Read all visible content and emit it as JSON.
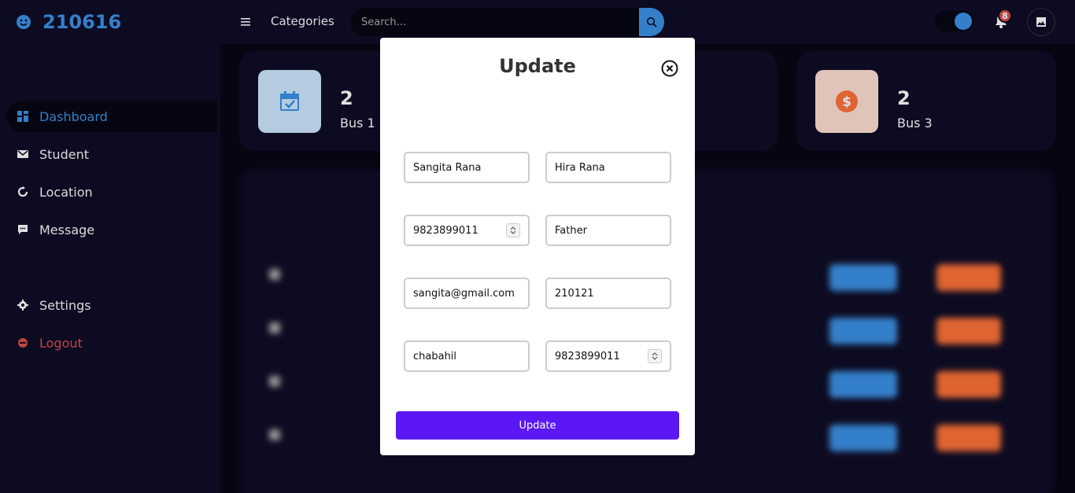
{
  "brand": {
    "name": "210616",
    "icon": "smile-icon"
  },
  "sidebar": {
    "top_items": [
      {
        "label": "Dashboard",
        "icon": "grid-icon",
        "active": true
      },
      {
        "label": "Student",
        "icon": "mail-icon"
      },
      {
        "label": "Location",
        "icon": "circle-arrow-icon"
      },
      {
        "label": "Message",
        "icon": "message-icon"
      }
    ],
    "bottom_items": [
      {
        "label": "Settings",
        "icon": "gear-icon"
      },
      {
        "label": "Logout",
        "icon": "logout-icon"
      }
    ]
  },
  "navbar": {
    "categories_label": "Categories",
    "search_placeholder": "Search...",
    "notification_count": "8"
  },
  "cards": [
    {
      "value": "2",
      "label": "Bus 1",
      "icon": "calendar-check-icon"
    },
    {
      "value": "2",
      "label": "Bus 3",
      "icon": "dollar-icon"
    }
  ],
  "modal": {
    "title": "Update",
    "fields": {
      "student_name": "Sangita Rana",
      "guardian_name": "Hira Rana",
      "phone": "9823899011",
      "relation": "Father",
      "email": "sangita@gmail.com",
      "id": "210121",
      "address": "chabahil",
      "guardian_phone": "9823899011"
    },
    "submit_label": "Update"
  },
  "colors": {
    "accent": "#3c91e6",
    "danger": "#db504a",
    "orange": "#fd7238",
    "purple": "#5b18f4",
    "bg": "#0f0d26"
  }
}
